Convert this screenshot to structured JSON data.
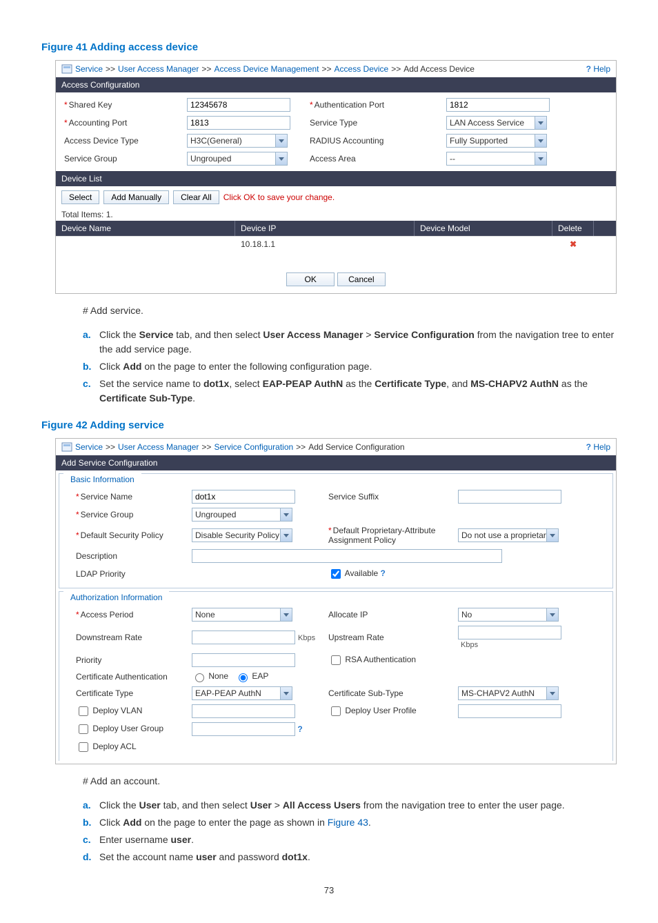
{
  "figures": {
    "fig41_title": "Figure 41 Adding access device",
    "fig42_title": "Figure 42 Adding service"
  },
  "help_label": "Help",
  "fig41": {
    "breadcrumb": {
      "service": "Service",
      "uam": "User Access Manager",
      "adm": "Access Device Management",
      "ad": "Access Device",
      "current": "Add Access Device"
    },
    "section_header": "Access Configuration",
    "fields": {
      "shared_key": "Shared Key",
      "shared_key_val": "12345678",
      "auth_port": "Authentication Port",
      "auth_port_val": "1812",
      "acct_port": "Accounting Port",
      "acct_port_val": "1813",
      "service_type": "Service Type",
      "service_type_val": "LAN Access Service",
      "access_device_type": "Access Device Type",
      "access_device_type_val": "H3C(General)",
      "radius_acct": "RADIUS Accounting",
      "radius_acct_val": "Fully Supported",
      "service_group": "Service Group",
      "service_group_val": "Ungrouped",
      "access_area": "Access Area",
      "access_area_val": "--"
    },
    "device_list_header": "Device List",
    "toolbar": {
      "select": "Select",
      "add_manually": "Add Manually",
      "clear_all": "Clear All",
      "hint": "Click OK to save your change."
    },
    "totals": "Total Items: 1.",
    "table": {
      "h1": "Device Name",
      "h2": "Device IP",
      "h3": "Device Model",
      "h4": "Delete",
      "row_ip": "10.18.1.1"
    },
    "ok": "OK",
    "cancel": "Cancel"
  },
  "doc1": {
    "heading": "# Add service.",
    "a_pre": "Click the ",
    "a_b1": "Service",
    "a_mid1": " tab, and then select ",
    "a_b2": "User Access Manager",
    "a_mid2": " > ",
    "a_b3": "Service Configuration",
    "a_post": " from the navigation tree to enter the add service page.",
    "b_pre": "Click ",
    "b_b1": "Add",
    "b_post": " on the page to enter the following configuration page.",
    "c_pre": "Set the service name to ",
    "c_b1": "dot1x",
    "c_mid1": ", select ",
    "c_b2": "EAP-PEAP AuthN",
    "c_mid2": " as the ",
    "c_b3": "Certificate Type",
    "c_mid3": ", and ",
    "c_b4": "MS-CHAPV2 AuthN",
    "c_mid4": " as the ",
    "c_b5": "Certificate Sub-Type",
    "c_post": "."
  },
  "fig42": {
    "breadcrumb": {
      "service": "Service",
      "uam": "User Access Manager",
      "sc": "Service Configuration",
      "current": "Add Service Configuration"
    },
    "section_header": "Add Service Configuration",
    "basic_title": "Basic Information",
    "basic": {
      "service_name": "Service Name",
      "service_name_val": "dot1x",
      "service_suffix": "Service Suffix",
      "service_group": "Service Group",
      "service_group_val": "Ungrouped",
      "default_sec_policy": "Default Security Policy",
      "default_sec_policy_val": "Disable Security Policy",
      "default_prop_attr": "Default Proprietary-Attribute Assignment Policy",
      "default_prop_attr_val": "Do not use a proprietar",
      "description": "Description",
      "ldap_priority": "LDAP Priority",
      "available": "Available"
    },
    "auth_title": "Authorization Information",
    "auth": {
      "access_period": "Access Period",
      "access_period_val": "None",
      "allocate_ip": "Allocate IP",
      "allocate_ip_val": "No",
      "downstream_rate": "Downstream Rate",
      "upstream_rate": "Upstream Rate",
      "kbps": "Kbps",
      "priority": "Priority",
      "rsa_auth": "RSA Authentication",
      "cert_auth": "Certificate Authentication",
      "cert_auth_none": "None",
      "cert_auth_eap": "EAP",
      "cert_type": "Certificate Type",
      "cert_type_val": "EAP-PEAP AuthN",
      "cert_subtype": "Certificate Sub-Type",
      "cert_subtype_val": "MS-CHAPV2 AuthN",
      "deploy_vlan": "Deploy VLAN",
      "deploy_user_profile": "Deploy User Profile",
      "deploy_user_group": "Deploy User Group",
      "deploy_acl": "Deploy ACL"
    }
  },
  "doc2": {
    "heading": "# Add an account.",
    "a_pre": "Click the ",
    "a_b1": "User",
    "a_mid1": " tab, and then select ",
    "a_b2": "User",
    "a_mid2": " > ",
    "a_b3": "All Access Users",
    "a_post": " from the navigation tree to enter the user page.",
    "b_pre": "Click ",
    "b_b1": "Add",
    "b_mid": " on the page to enter the page as shown in ",
    "b_link": "Figure 43",
    "b_post": ".",
    "c_pre": "Enter username ",
    "c_b1": "user",
    "c_post": ".",
    "d_pre": "Set the account name ",
    "d_b1": "user",
    "d_mid": " and password ",
    "d_b2": "dot1x",
    "d_post": "."
  },
  "page_number": "73"
}
